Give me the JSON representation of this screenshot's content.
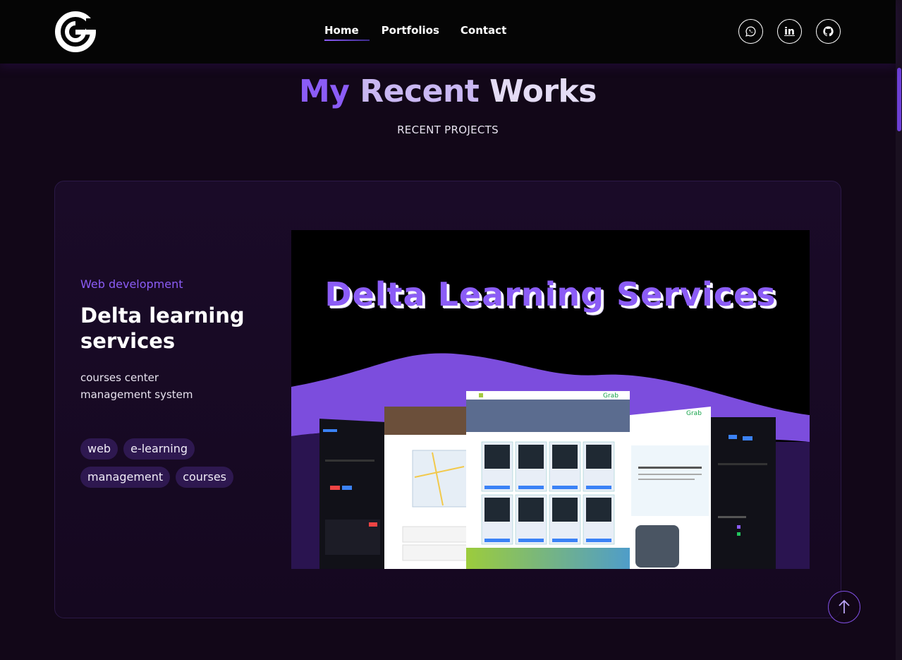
{
  "header": {
    "logo_letter": "G",
    "nav": [
      {
        "label": "Home",
        "active": true
      },
      {
        "label": "Portfolios",
        "active": false
      },
      {
        "label": "Contact",
        "active": false
      }
    ],
    "socials": [
      {
        "name": "whatsapp-icon"
      },
      {
        "name": "linkedin-icon",
        "glyph": "in"
      },
      {
        "name": "github-icon"
      }
    ]
  },
  "section": {
    "title_part1": "My",
    "title_part2": "Recent",
    "title_part3": "Works",
    "subtitle": "RECENT PROJECTS"
  },
  "project": {
    "category": "Web development",
    "title": "Delta learning services",
    "description": "courses center management system",
    "tags": [
      "web",
      "e-learning",
      "management",
      "courses"
    ],
    "image_title": "Delta Learning Services",
    "image_brand": "Grab"
  },
  "colors": {
    "accent": "#8b5cf6",
    "background": "#120718",
    "tag_bg": "#2e1850"
  }
}
